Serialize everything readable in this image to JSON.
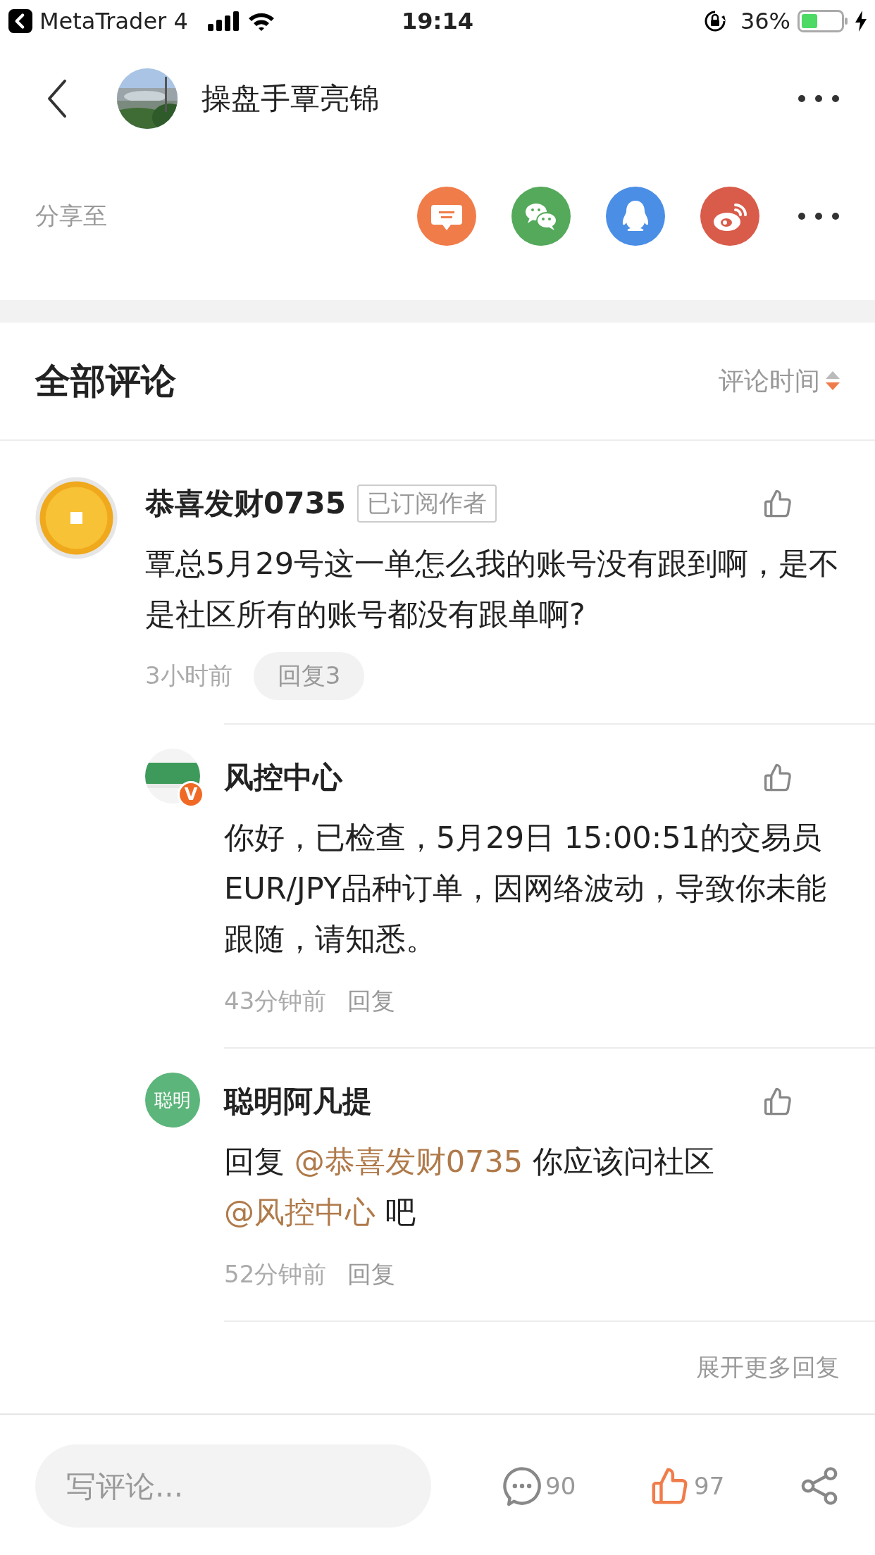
{
  "status_bar": {
    "back_app": "MetaTrader 4",
    "time": "19:14",
    "battery": "36%"
  },
  "header": {
    "title": "操盘手覃亮锦"
  },
  "share": {
    "label": "分享至"
  },
  "comments_header": {
    "title": "全部评论",
    "sort": "评论时间"
  },
  "comments": [
    {
      "author": "恭喜发财0735",
      "avatar": {
        "kind": "coin"
      },
      "badge": "已订阅作者",
      "liked": false,
      "body": [
        {
          "kind": "plain",
          "text": "覃总5月29号这一单怎么我的账号没有跟到啊，是不是社区所有的账号都没有跟单啊?"
        }
      ],
      "time": "3小时前",
      "reply": "回复3",
      "replies": [
        {
          "author": "风控中心",
          "avatar": {
            "kind": "logo",
            "badge": "V"
          },
          "liked": false,
          "body": [
            {
              "kind": "plain",
              "text": "你好，已检查，5月29日 15:00:51的交易员EUR/JPY品种订单，因网络波动，导致你未能跟随，请知悉。"
            }
          ],
          "time": "43分钟前",
          "reply": "回复"
        },
        {
          "author": "聪明阿凡提",
          "avatar": {
            "kind": "text",
            "text": "聪明"
          },
          "liked": false,
          "body": [
            {
              "kind": "plain",
              "text": "回复 "
            },
            {
              "kind": "mention",
              "text": "@恭喜发财0735"
            },
            {
              "kind": "plain",
              "text": " 你应该问社区"
            },
            {
              "kind": "mention",
              "text": "@风控中心"
            },
            {
              "kind": "plain",
              "text": " 吧"
            }
          ],
          "time": "52分钟前",
          "reply": "回复"
        }
      ]
    }
  ],
  "more_replies": "展开更多回复",
  "bottom_bar": {
    "placeholder": "写评论...",
    "comment_count": "90",
    "like_count": "97",
    "liked": true
  }
}
